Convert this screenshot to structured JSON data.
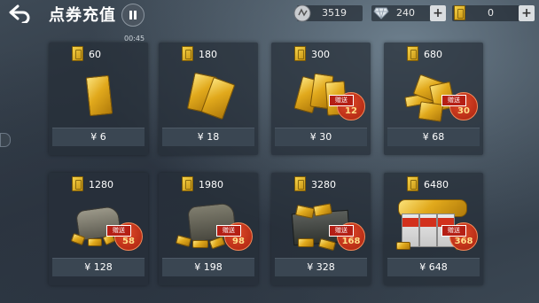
{
  "header": {
    "title": "点券充值",
    "timer": "00:45"
  },
  "resources": {
    "coins": "3519",
    "diamonds": "240",
    "tickets": "0",
    "plus_label": "+"
  },
  "packages": [
    {
      "amount": "60",
      "price": "¥ 6",
      "bonus_label": "",
      "bonus": ""
    },
    {
      "amount": "180",
      "price": "¥ 18",
      "bonus_label": "",
      "bonus": ""
    },
    {
      "amount": "300",
      "price": "¥ 30",
      "bonus_label": "赠送",
      "bonus": "12"
    },
    {
      "amount": "680",
      "price": "¥ 68",
      "bonus_label": "赠送",
      "bonus": "30"
    },
    {
      "amount": "1280",
      "price": "¥ 128",
      "bonus_label": "赠送",
      "bonus": "58"
    },
    {
      "amount": "1980",
      "price": "¥ 198",
      "bonus_label": "赠送",
      "bonus": "98"
    },
    {
      "amount": "3280",
      "price": "¥ 328",
      "bonus_label": "赠送",
      "bonus": "168"
    },
    {
      "amount": "6480",
      "price": "¥ 648",
      "bonus_label": "赠送",
      "bonus": "368"
    }
  ]
}
